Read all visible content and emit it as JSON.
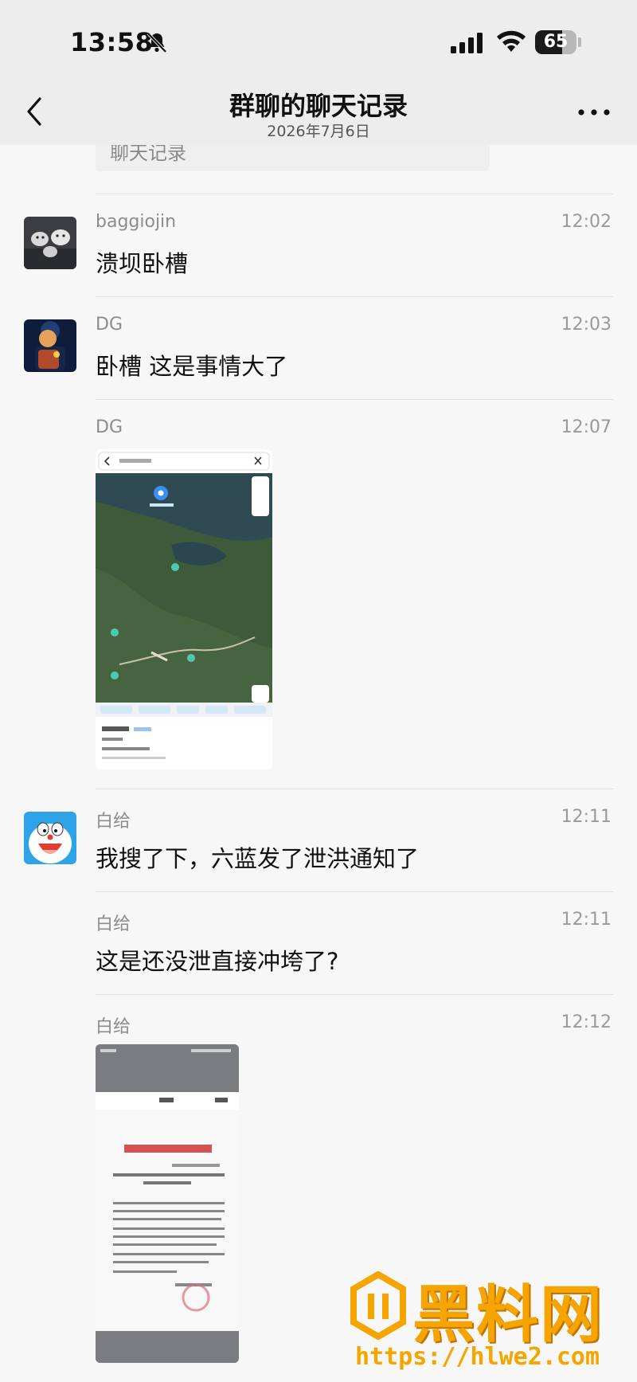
{
  "status_bar": {
    "time": "13:58",
    "battery_level": "65",
    "battery_fraction": 0.65,
    "icons": [
      "bell-muted-icon",
      "cellular-signal-icon",
      "wifi-icon",
      "battery-icon"
    ]
  },
  "nav": {
    "title": "群聊的聊天记录",
    "subtitle": "2026年7月6日",
    "back_icon": "chevron-left-icon",
    "more_icon": "more-dots-icon"
  },
  "prev_card": {
    "text": "聊天记录"
  },
  "messages": [
    {
      "sender": "baggiojin",
      "time": "12:02",
      "text": "溃坝卧槽"
    },
    {
      "sender": "DG",
      "time": "12:03",
      "text": "卧槽 这是事情大了"
    },
    {
      "sender": "DG",
      "time": "12:07"
    },
    {
      "sender": "白给",
      "time": "12:11",
      "text": "我搜了下，六蓝发了泄洪通知了"
    },
    {
      "sender": "白给",
      "time": "12:11",
      "text": "这是还没泄直接冲垮了?"
    },
    {
      "sender": "白给",
      "time": "12:12"
    }
  ],
  "watermark": {
    "title": "黑料网",
    "url": "https://hlwe2.com"
  },
  "colors": {
    "background": "#f7f7f7",
    "header": "#ededed",
    "watermark": "#f5a400",
    "map_green": "#3f5a3a",
    "map_water": "#2f4a52"
  }
}
